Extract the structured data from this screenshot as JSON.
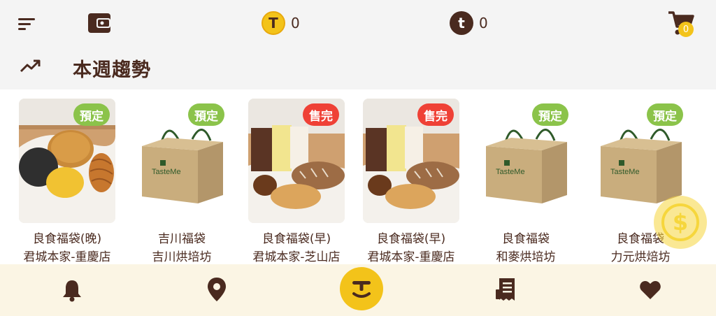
{
  "header": {
    "menu_icon": "menu-icon",
    "wallet_icon": "wallet-icon",
    "coin_gold": {
      "symbol": "T",
      "value": "0"
    },
    "coin_brown": {
      "symbol": "t",
      "value": "0"
    },
    "cart": {
      "icon": "cart-icon",
      "count": "0"
    }
  },
  "section": {
    "icon": "trending-up-icon",
    "title": "本週趨勢"
  },
  "products": [
    {
      "badge": "預定",
      "badge_type": "pre",
      "name": "良食福袋(晚)",
      "shop": "君城本家-重慶店",
      "image": "bread-photo"
    },
    {
      "badge": "預定",
      "badge_type": "pre",
      "name": "吉川福袋",
      "shop": "吉川烘培坊",
      "image": "paper-bag"
    },
    {
      "badge": "售完",
      "badge_type": "sold",
      "name": "良食福袋(早)",
      "shop": "君城本家-芝山店",
      "image": "cake-photo"
    },
    {
      "badge": "售完",
      "badge_type": "sold",
      "name": "良食福袋(早)",
      "shop": "君城本家-重慶店",
      "image": "cake-photo"
    },
    {
      "badge": "預定",
      "badge_type": "pre",
      "name": "良食福袋",
      "shop": "和麥烘培坊",
      "image": "paper-bag"
    },
    {
      "badge": "預定",
      "badge_type": "pre",
      "name": "良食福袋",
      "shop": "力元烘焙坊",
      "image": "paper-bag"
    }
  ],
  "bag_text": "TasteMe",
  "floating_button": {
    "icon": "dollar-icon"
  },
  "bottom_nav": [
    {
      "icon": "bell-icon"
    },
    {
      "icon": "location-pin-icon"
    },
    {
      "icon": "home-logo-icon"
    },
    {
      "icon": "receipt-icon"
    },
    {
      "icon": "heart-icon"
    }
  ],
  "colors": {
    "brand_brown": "#4a2a1f",
    "accent_yellow": "#f3c31a",
    "preorder_green": "#8bc34a",
    "soldout_red": "#ef4136",
    "bottom_bar_bg": "#fbf5e4"
  }
}
